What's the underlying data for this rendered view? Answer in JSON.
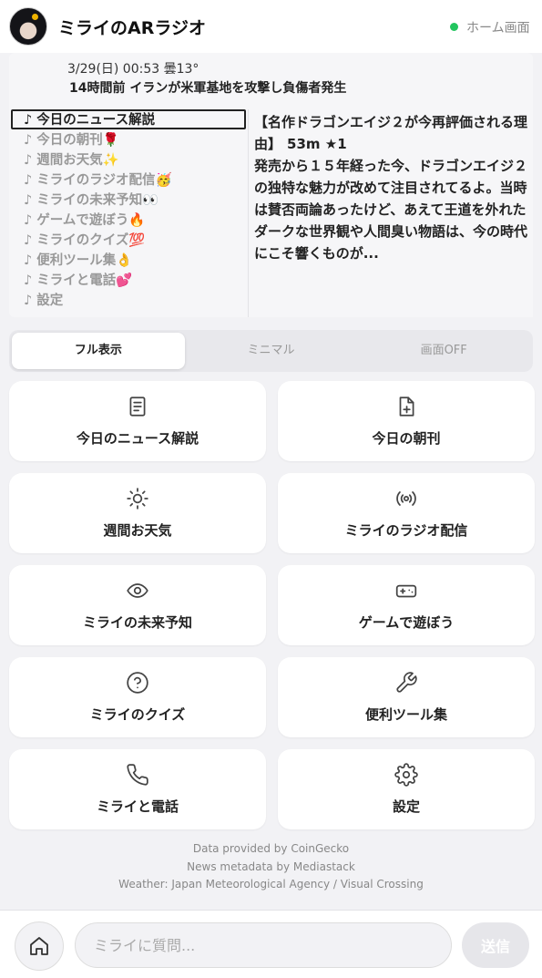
{
  "header": {
    "app_title": "ミライのARラジオ",
    "status_label": "ホーム画面",
    "status_color": "#22c55e"
  },
  "display": {
    "datetime_weather": "3/29(日) 00:53  曇13°",
    "headline": "14時間前 イランが米軍基地を攻撃し負傷者発生",
    "menu": [
      {
        "label": "♪ 今日のニュース解説",
        "active": true
      },
      {
        "label": "♪ 今日の朝刊🌹"
      },
      {
        "label": "♪ 週間お天気✨"
      },
      {
        "label": "♪ ミライのラジオ配信🥳"
      },
      {
        "label": "♪ ミライの未来予知👀"
      },
      {
        "label": "♪ ゲームで遊ぼう🔥"
      },
      {
        "label": "♪ ミライのクイズ💯"
      },
      {
        "label": "♪ 便利ツール集👌"
      },
      {
        "label": "♪ ミライと電話💕"
      },
      {
        "label": "♪ 設定"
      }
    ],
    "article": {
      "title": "【名作ドラゴンエイジ２が今再評価される理由】",
      "meta": "53m ★1",
      "body": "発売から１５年経った今、ドラゴンエイジ２の独特な魅力が改めて注目されてるよ。当時は賛否両論あったけど、あえて王道を外れたダークな世界観や人間臭い物語は、今の時代にこそ響くものが..."
    }
  },
  "display_modes": [
    {
      "label": "フル表示",
      "active": true
    },
    {
      "label": "ミニマル"
    },
    {
      "label": "画面OFF"
    }
  ],
  "tiles": [
    {
      "label": "今日のニュース解説",
      "icon": "document-icon"
    },
    {
      "label": "今日の朝刊",
      "icon": "file-plus-icon"
    },
    {
      "label": "週間お天気",
      "icon": "sun-icon"
    },
    {
      "label": "ミライのラジオ配信",
      "icon": "broadcast-icon"
    },
    {
      "label": "ミライの未来予知",
      "icon": "eye-icon"
    },
    {
      "label": "ゲームで遊ぼう",
      "icon": "gamepad-icon"
    },
    {
      "label": "ミライのクイズ",
      "icon": "question-icon"
    },
    {
      "label": "便利ツール集",
      "icon": "wrench-icon"
    },
    {
      "label": "ミライと電話",
      "icon": "phone-icon"
    },
    {
      "label": "設定",
      "icon": "gear-icon"
    }
  ],
  "credits": [
    "Data provided by CoinGecko",
    "News metadata by Mediastack",
    "Weather: Japan Meteorological Agency / Visual Crossing"
  ],
  "chat": {
    "placeholder": "ミライに質問...",
    "send_label": "送信"
  }
}
